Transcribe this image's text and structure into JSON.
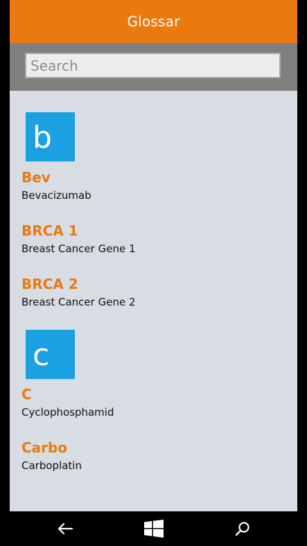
{
  "header": {
    "title": "Glossar"
  },
  "search": {
    "placeholder": "Search",
    "value": ""
  },
  "groups": [
    {
      "letter": "b",
      "entries": [
        {
          "term": "Bev",
          "description": "Bevacizumab"
        },
        {
          "term": "BRCA 1",
          "description": "Breast Cancer Gene 1"
        },
        {
          "term": "BRCA 2",
          "description": "Breast Cancer Gene 2"
        }
      ]
    },
    {
      "letter": "c",
      "entries": [
        {
          "term": "C",
          "description": "Cyclophosphamid"
        },
        {
          "term": "Carbo",
          "description": "Carboplatin"
        }
      ]
    }
  ],
  "navbar": {
    "back_icon": "back-arrow-icon",
    "home_icon": "windows-start-icon",
    "search_icon": "search-icon"
  },
  "colors": {
    "accent": "#ea7a10",
    "tile": "#1ba1e2",
    "background": "#d8dce3",
    "searchbar": "#7f7f7f"
  }
}
